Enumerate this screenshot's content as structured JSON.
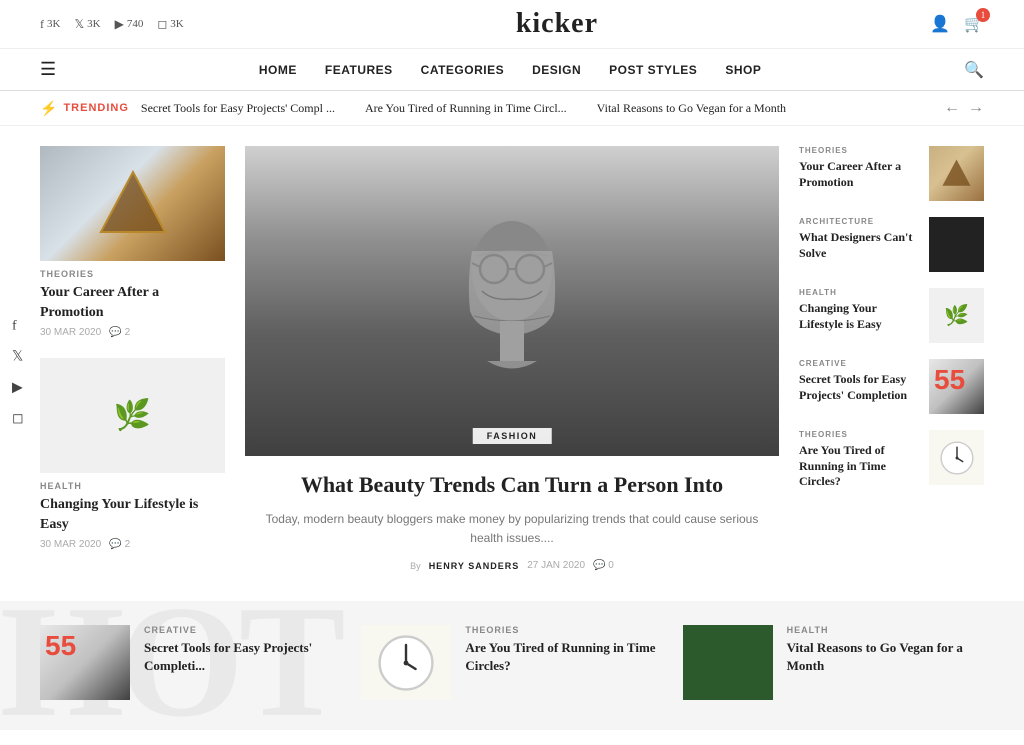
{
  "site": {
    "logo": "kicker",
    "cart_count": "1"
  },
  "social": {
    "facebook": {
      "label": "f",
      "count": "3K"
    },
    "twitter": {
      "label": "🐦",
      "count": "3K"
    },
    "youtube": {
      "label": "▶",
      "count": "740"
    },
    "instagram": {
      "label": "📷",
      "count": "3K"
    }
  },
  "nav": {
    "items": [
      "HOME",
      "FEATURES",
      "CATEGORIES",
      "DESIGN",
      "POST STYLES",
      "SHOP"
    ]
  },
  "trending": {
    "label": "TRENDING",
    "items": [
      "Secret Tools for Easy Projects' Compl ...",
      "Are You Tired of Running in Time Circl...",
      "Vital Reasons to Go Vegan for a Month"
    ]
  },
  "left_articles": [
    {
      "category": "THEORIES",
      "title": "Your Career After a Promotion",
      "date": "30 MAR 2020",
      "comments": "2"
    },
    {
      "category": "HEALTH",
      "title": "Changing Your Lifestyle is Easy",
      "date": "30 MAR 2020",
      "comments": "2"
    }
  ],
  "featured": {
    "category": "FASHION",
    "title": "What Beauty Trends Can Turn a Person Into",
    "description": "Today, modern beauty bloggers make money by popularizing trends that could cause serious health issues....",
    "author": "HENRY SANDERS",
    "date": "27 JAN 2020",
    "comments": "0"
  },
  "right_articles": [
    {
      "category": "THEORIES",
      "title": "Your Career After a Promotion"
    },
    {
      "category": "ARCHITECTURE",
      "title": "What Designers Can't Solve"
    },
    {
      "category": "HEALTH",
      "title": "Changing Your Lifestyle is Easy"
    },
    {
      "category": "CREATIVE",
      "title": "Secret Tools for Easy Projects' Completion"
    },
    {
      "category": "THEORIES",
      "title": "Are You Tired of Running in Time Circles?"
    }
  ],
  "bottom_articles": [
    {
      "category": "CREATIVE",
      "title": "Secret Tools for Easy Projects' Completi..."
    },
    {
      "category": "THEORIES",
      "title": "Are You Tired of Running in Time Circles?"
    },
    {
      "category": "HEALTH",
      "title": "Vital Reasons to Go Vegan for a Month"
    }
  ],
  "float_social": {
    "items": [
      "f",
      "🐦",
      "▶",
      "📷"
    ]
  }
}
